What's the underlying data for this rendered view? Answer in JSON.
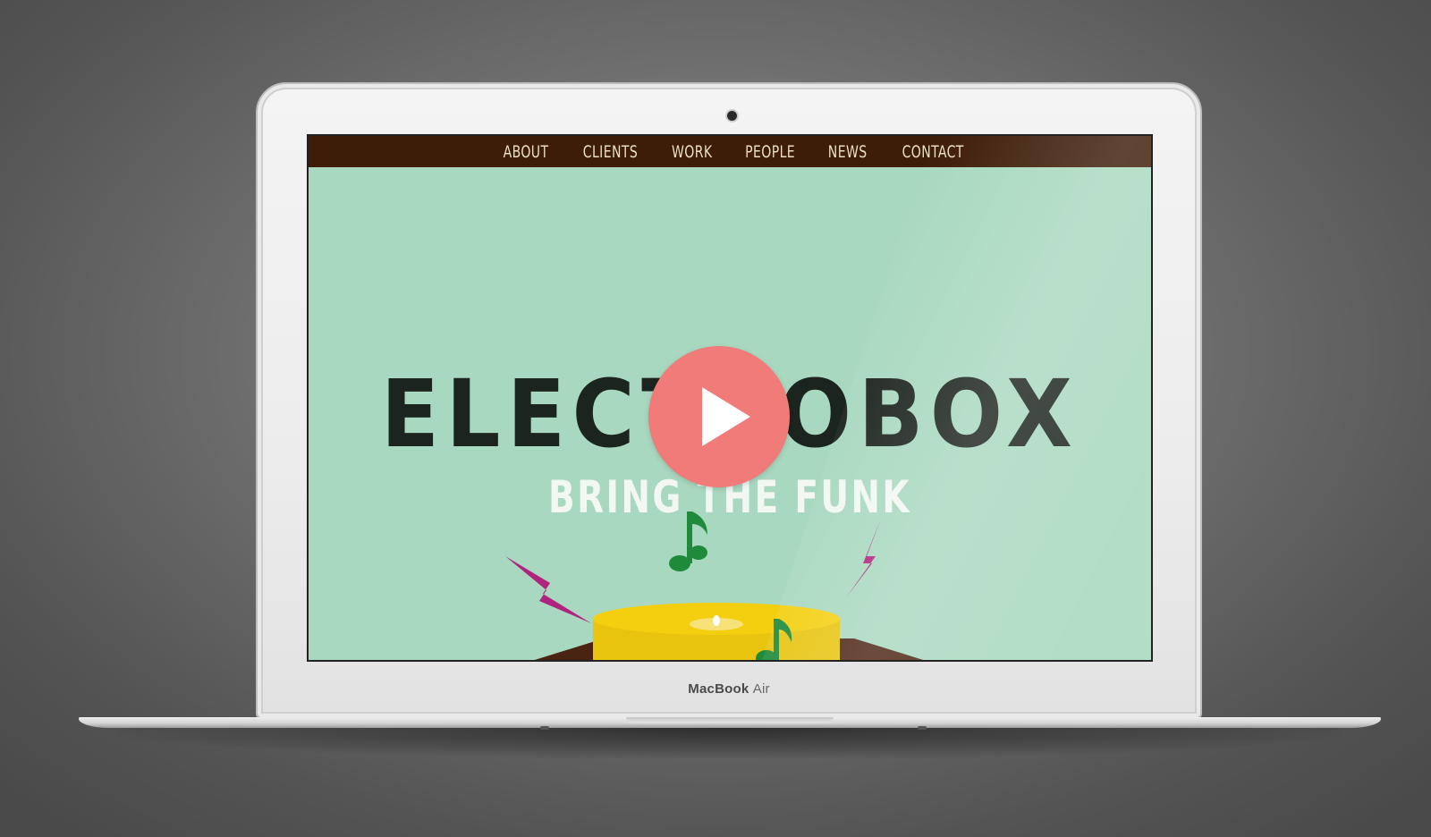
{
  "website": {
    "nav": [
      "ABOUT",
      "CLIENTS",
      "WORK",
      "PEOPLE",
      "NEWS",
      "CONTACT"
    ],
    "hero_title": "ELECTROBOX",
    "tagline": "BRING THE FUNK"
  },
  "device": {
    "label_bold": "MacBook",
    "label_light": "Air"
  },
  "video": {
    "play_icon": "play-icon"
  },
  "colors": {
    "nav_background": "#3d1c08",
    "screen_background": "#a8d8bf",
    "play_button": "#f07b78",
    "note_green": "#1f8a3a",
    "bolt_magenta": "#b0237e",
    "speaker_yellow": "#f4cf10"
  }
}
